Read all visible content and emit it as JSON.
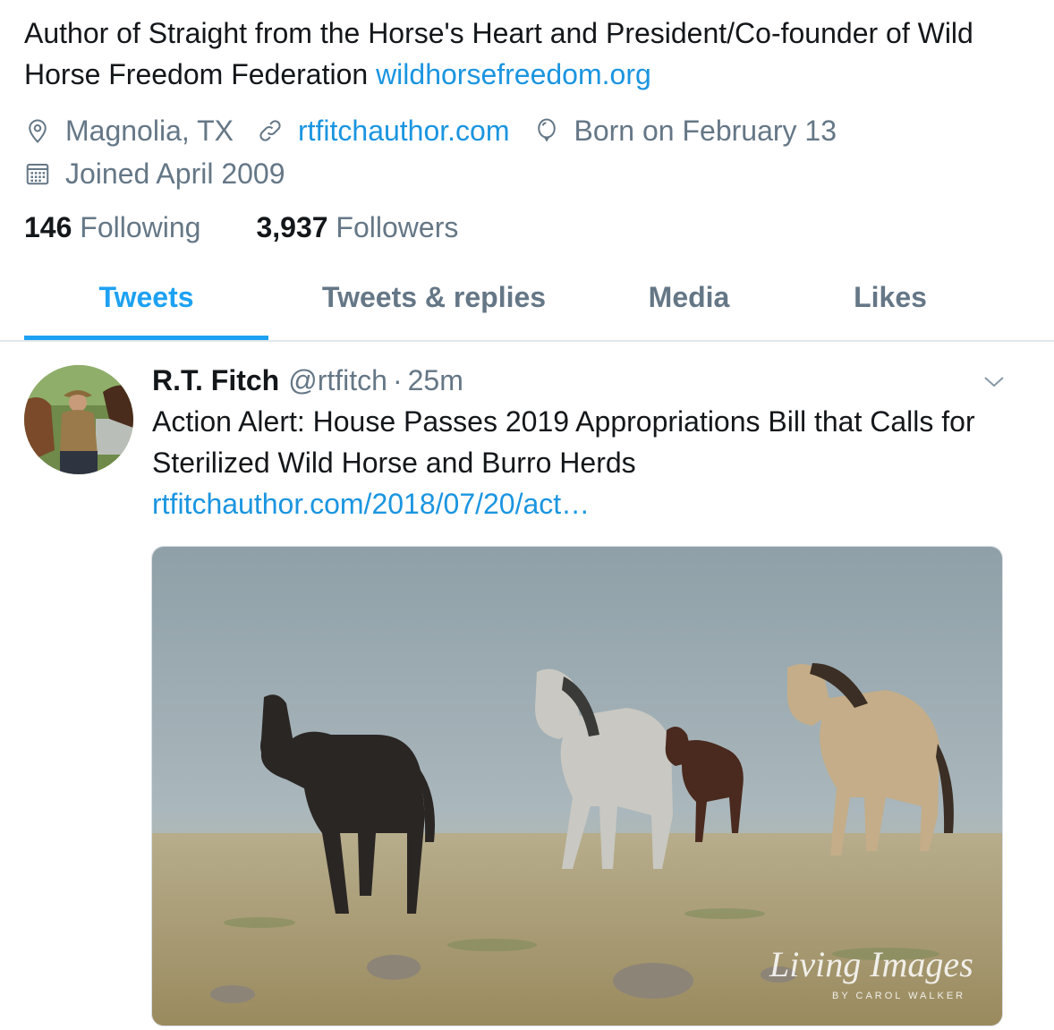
{
  "profile": {
    "bio_text": "Author of Straight from the Horse's Heart and President/Co-founder of Wild Horse Freedom Federation ",
    "bio_link": "wildhorsefreedom.org",
    "location": "Magnolia, TX",
    "website": "rtfitchauthor.com",
    "birthday": "Born on February 13",
    "joined": "Joined April 2009",
    "following_count": "146",
    "following_label": "Following",
    "followers_count": "3,937",
    "followers_label": "Followers",
    "icons": [
      "location-icon",
      "link-icon",
      "balloon-icon",
      "calendar-icon"
    ]
  },
  "tabs": [
    {
      "label": "Tweets",
      "active": true
    },
    {
      "label": "Tweets & replies",
      "active": false
    },
    {
      "label": "Media",
      "active": false
    },
    {
      "label": "Likes",
      "active": false
    }
  ],
  "tweet": {
    "name": "R.T. Fitch",
    "handle": "@rtfitch",
    "separator": "·",
    "time": "25m",
    "text": "Action Alert: House Passes 2019 Appropriations Bill that Calls for Sterilized Wild Horse and Burro Herds",
    "link": "rtfitchauthor.com/2018/07/20/act…",
    "media_watermark": "Living Images",
    "media_watermark_sub": "BY CAROL WALKER"
  },
  "colors": {
    "accent": "#1da1f2",
    "link": "#1b95e0",
    "secondary_text": "#657786",
    "primary_text": "#14171a"
  }
}
